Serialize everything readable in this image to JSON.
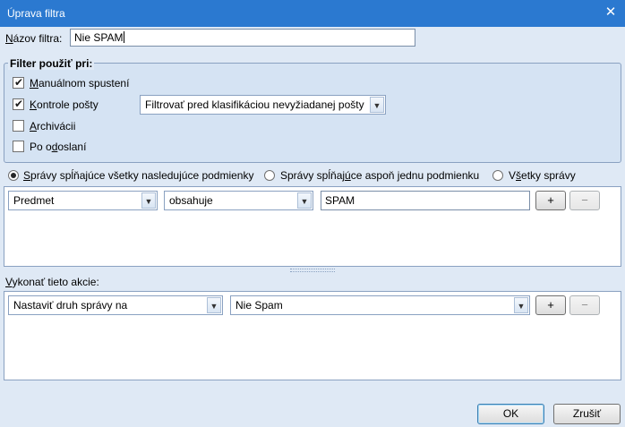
{
  "window": {
    "title": "Úprava filtra",
    "close_glyph": "✕"
  },
  "filter_name": {
    "label_prefix": "N",
    "label_rest": "ázov filtra:",
    "value": "Nie SPAM"
  },
  "apply_when": {
    "legend": "Filter použiť pri:",
    "manual": {
      "label_a": "",
      "label_u": "M",
      "label_b": "anuálnom spustení",
      "checked": true
    },
    "mail_check": {
      "label_a": "",
      "label_u": "K",
      "label_b": "ontrole pošty",
      "checked": true
    },
    "archive": {
      "label_a": "",
      "label_u": "A",
      "label_b": "rchivácii",
      "checked": false
    },
    "after_send": {
      "label_a": "Po o",
      "label_u": "d",
      "label_b": "oslaní",
      "checked": false
    },
    "timing_select": "Filtrovať pred klasifikáciou nevyžiadanej pošty"
  },
  "match": {
    "all": {
      "label_a": "",
      "label_u": "S",
      "label_b": "právy spĺňajúce všetky nasledujúce podmienky",
      "selected": true
    },
    "any": {
      "label_a": "Správy spĺňaj",
      "label_u": "ú",
      "label_b": "ce aspoň jednu podmienku",
      "selected": false
    },
    "everything": {
      "label_a": "V",
      "label_u": "š",
      "label_b": "etky správy",
      "selected": false
    }
  },
  "condition": {
    "field": "Predmet",
    "operator": "obsahuje",
    "value": "SPAM",
    "add_label": "+",
    "remove_label": "−"
  },
  "actions": {
    "label_a": "",
    "label_u": "V",
    "label_b": "ykonať tieto akcie:",
    "action": "Nastaviť druh správy na",
    "value": "Nie Spam",
    "add_label": "+",
    "remove_label": "−"
  },
  "buttons": {
    "ok": "OK",
    "cancel": "Zrušiť"
  },
  "icons": {
    "checkmark": "✔",
    "dropdown": "▼"
  }
}
